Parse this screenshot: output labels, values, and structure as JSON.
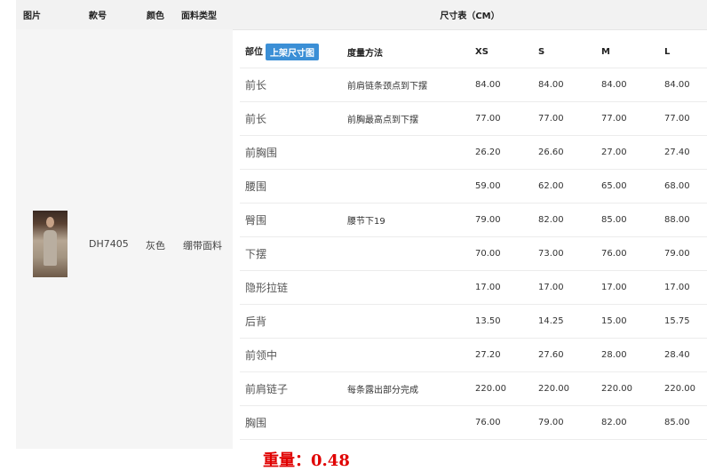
{
  "product_table": {
    "headers": [
      "图片",
      "款号",
      "颜色",
      "面料类型"
    ],
    "row": {
      "image": "dress-thumbnail",
      "style_no": "DH7405",
      "color": "灰色",
      "fabric": "绷带面料"
    }
  },
  "size_chart": {
    "title": "尺寸表（CM）",
    "part_header": "部位",
    "size_button": "上架尺寸图",
    "method_header": "度量方法",
    "size_columns": [
      "XS",
      "S",
      "M",
      "L"
    ],
    "rows": [
      {
        "part": "前长",
        "method": "前肩链条颈点到下摆",
        "values": [
          "84.00",
          "84.00",
          "84.00",
          "84.00"
        ]
      },
      {
        "part": "前长",
        "method": "前胸最高点到下摆",
        "values": [
          "77.00",
          "77.00",
          "77.00",
          "77.00"
        ]
      },
      {
        "part": "前胸围",
        "method": "",
        "values": [
          "26.20",
          "26.60",
          "27.00",
          "27.40"
        ]
      },
      {
        "part": "腰围",
        "method": "",
        "values": [
          "59.00",
          "62.00",
          "65.00",
          "68.00"
        ]
      },
      {
        "part": "臀围",
        "method": "腰节下19",
        "values": [
          "79.00",
          "82.00",
          "85.00",
          "88.00"
        ]
      },
      {
        "part": "下摆",
        "method": "",
        "values": [
          "70.00",
          "73.00",
          "76.00",
          "79.00"
        ]
      },
      {
        "part": "隐形拉链",
        "method": "",
        "values": [
          "17.00",
          "17.00",
          "17.00",
          "17.00"
        ]
      },
      {
        "part": "后背",
        "method": "",
        "values": [
          "13.50",
          "14.25",
          "15.00",
          "15.75"
        ]
      },
      {
        "part": "前领中",
        "method": "",
        "values": [
          "27.20",
          "27.60",
          "28.00",
          "28.40"
        ]
      },
      {
        "part": "前肩链子",
        "method": "每条露出部分完成",
        "values": [
          "220.00",
          "220.00",
          "220.00",
          "220.00"
        ]
      },
      {
        "part": "胸围",
        "method": "",
        "values": [
          "76.00",
          "79.00",
          "82.00",
          "85.00"
        ]
      }
    ]
  },
  "weight_text": "重量：0.48",
  "colors": {
    "header_bg": "#f2f2f2",
    "badge": "#3b8fd6",
    "weight": "#e00000"
  }
}
